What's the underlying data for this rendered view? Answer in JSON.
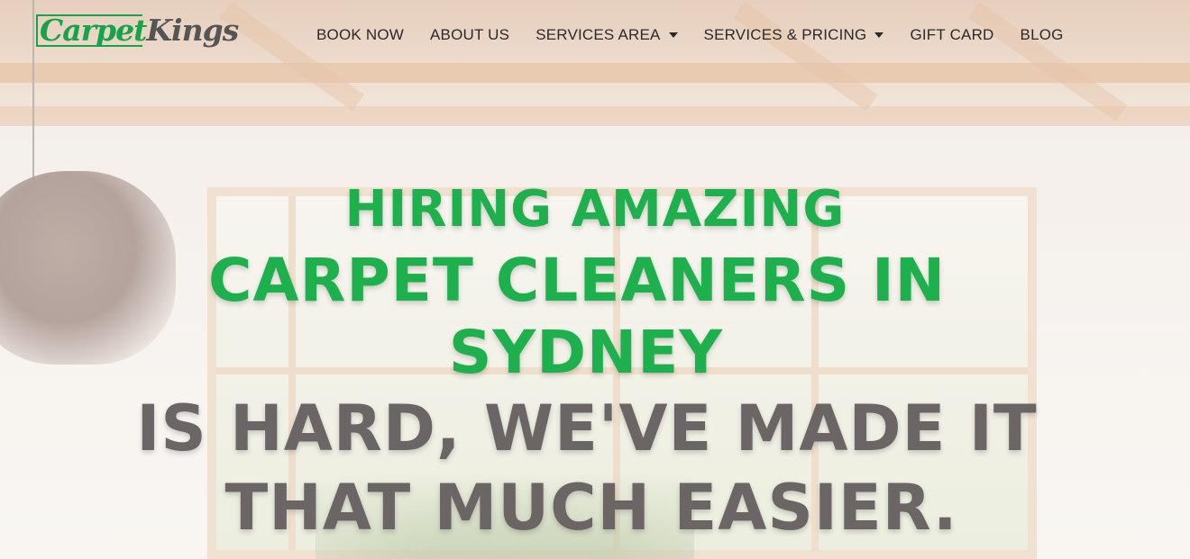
{
  "brand": {
    "logo_part1": "Carpet",
    "logo_part2": "Kings",
    "primary_color": "#1db04c",
    "text_gray": "#6b6566"
  },
  "nav": {
    "items": [
      {
        "label": "BOOK NOW",
        "has_dropdown": false
      },
      {
        "label": "ABOUT US",
        "has_dropdown": false
      },
      {
        "label": "SERVICES AREA",
        "has_dropdown": true
      },
      {
        "label": "SERVICES & PRICING",
        "has_dropdown": true
      },
      {
        "label": "GIFT CARD",
        "has_dropdown": false
      },
      {
        "label": "BLOG",
        "has_dropdown": false
      }
    ]
  },
  "hero": {
    "line1": "HIRING AMAZING",
    "line2": "CARPET CLEANERS IN",
    "line3": "SYDNEY",
    "line4": "IS HARD, WE'VE MADE IT",
    "line5": "THAT MUCH EASIER."
  }
}
